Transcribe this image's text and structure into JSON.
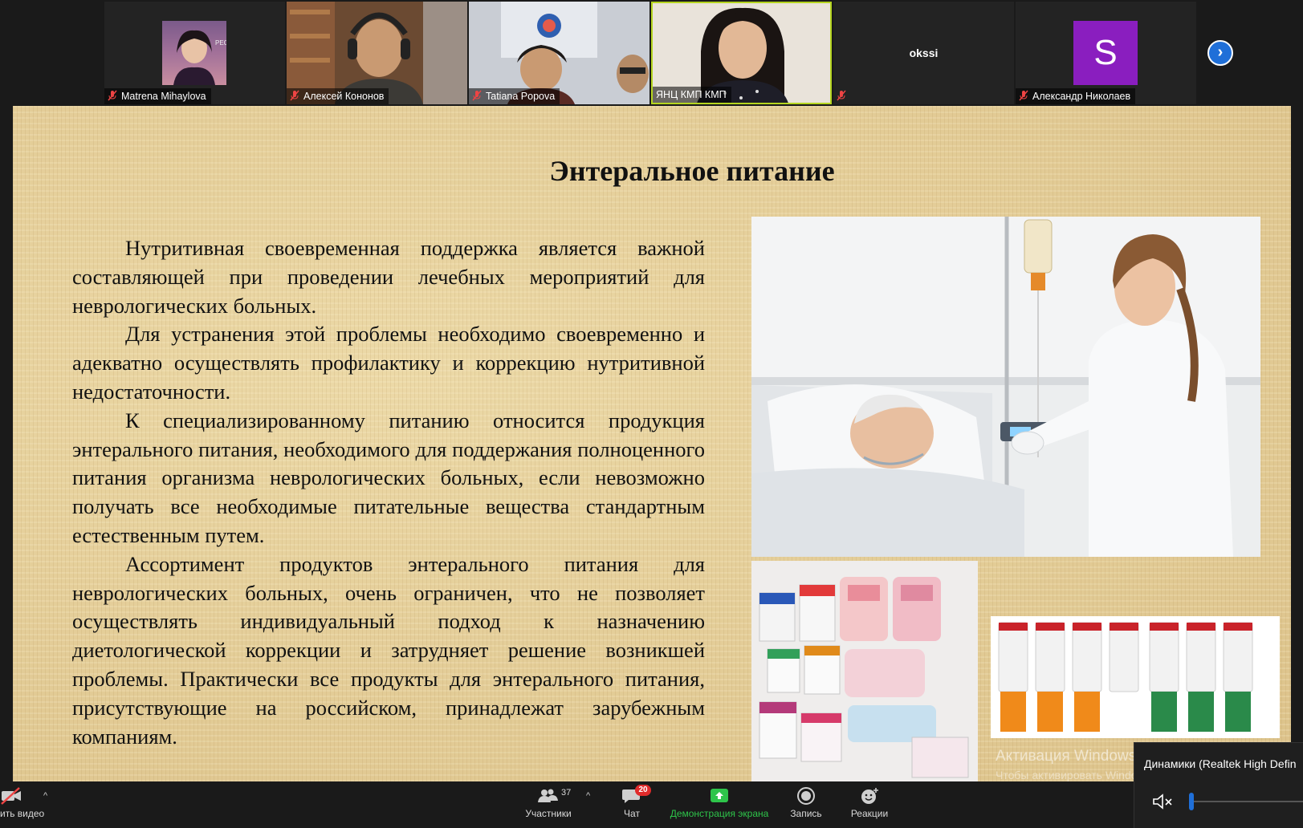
{
  "participants": [
    {
      "name": "Matrena Mihaylova",
      "muted": true
    },
    {
      "name": "Алексей Кононов",
      "muted": true
    },
    {
      "name": "Tatiana Popova",
      "muted": true
    },
    {
      "name": "ЯНЦ КМП КМП",
      "muted": false,
      "active_speaker": true
    },
    {
      "name": "okssi",
      "muted": true
    },
    {
      "name": "Александр Николаев",
      "muted": true,
      "avatar_letter": "S"
    }
  ],
  "slide": {
    "title": "Энтеральное питание",
    "paragraphs": [
      "Нутритивная своевременная поддержка является важной составляющей при проведении лечебных мероприятий для неврологических больных.",
      "Для устранения этой проблемы необходимо своевременно и адекватно осуществлять профилактику и коррекцию нутритивной недостаточности.",
      "К специализированному питанию относится продукция энтерального питания, необходимого для поддержания полноценного питания организма неврологических больных, если невозможно получать все необходимые питательные вещества стандартным естественным путем.",
      "Ассортимент продуктов энтерального питания для неврологических больных, очень ограничен, что не позволяет осуществлять индивидуальный подход к назначению диетологической коррекции и затрудняет решение возникшей проблемы. Практически все продукты для энтерального питания, присутствующие на российском, принадлежат зарубежным компаниям."
    ]
  },
  "watermark": {
    "line1": "Активация Windows",
    "line2": "Чтобы активировать Windows, перейдите в раздел \"Па"
  },
  "toolbar": {
    "video_label": "ить видео",
    "participants_label": "Участники",
    "participants_count": "37",
    "chat_label": "Чат",
    "chat_badge": "20",
    "share_label": "Демонстрация экрана",
    "record_label": "Запись",
    "reactions_label": "Реакции"
  },
  "speaker_popup": {
    "device": "Динамики (Realtek High Defin"
  },
  "colors": {
    "active_border": "#b5d51f",
    "share_green": "#2ec44a",
    "badge_red": "#e02b2b",
    "accent_blue": "#1f6fd8"
  }
}
